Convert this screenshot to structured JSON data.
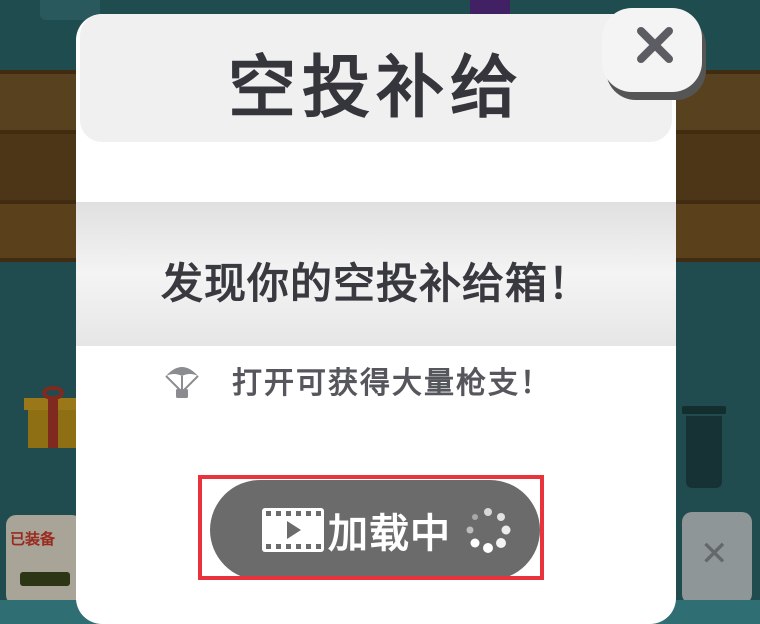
{
  "dialog": {
    "title": "空投补给",
    "message": "发现你的空投补给箱！",
    "subtitle": "打开可获得大量枪支！",
    "subtitle_icon": "parachute-icon",
    "close_icon": "close-icon"
  },
  "ad_button": {
    "label": "加载中",
    "left_icon": "film-play-icon",
    "right_icon": "loading-spinner-icon",
    "state": "loading"
  },
  "background": {
    "equip_label": "已装备"
  },
  "colors": {
    "button_bg": "#6b6b6b",
    "highlight": "#e8323c",
    "title_text": "#34363b"
  }
}
